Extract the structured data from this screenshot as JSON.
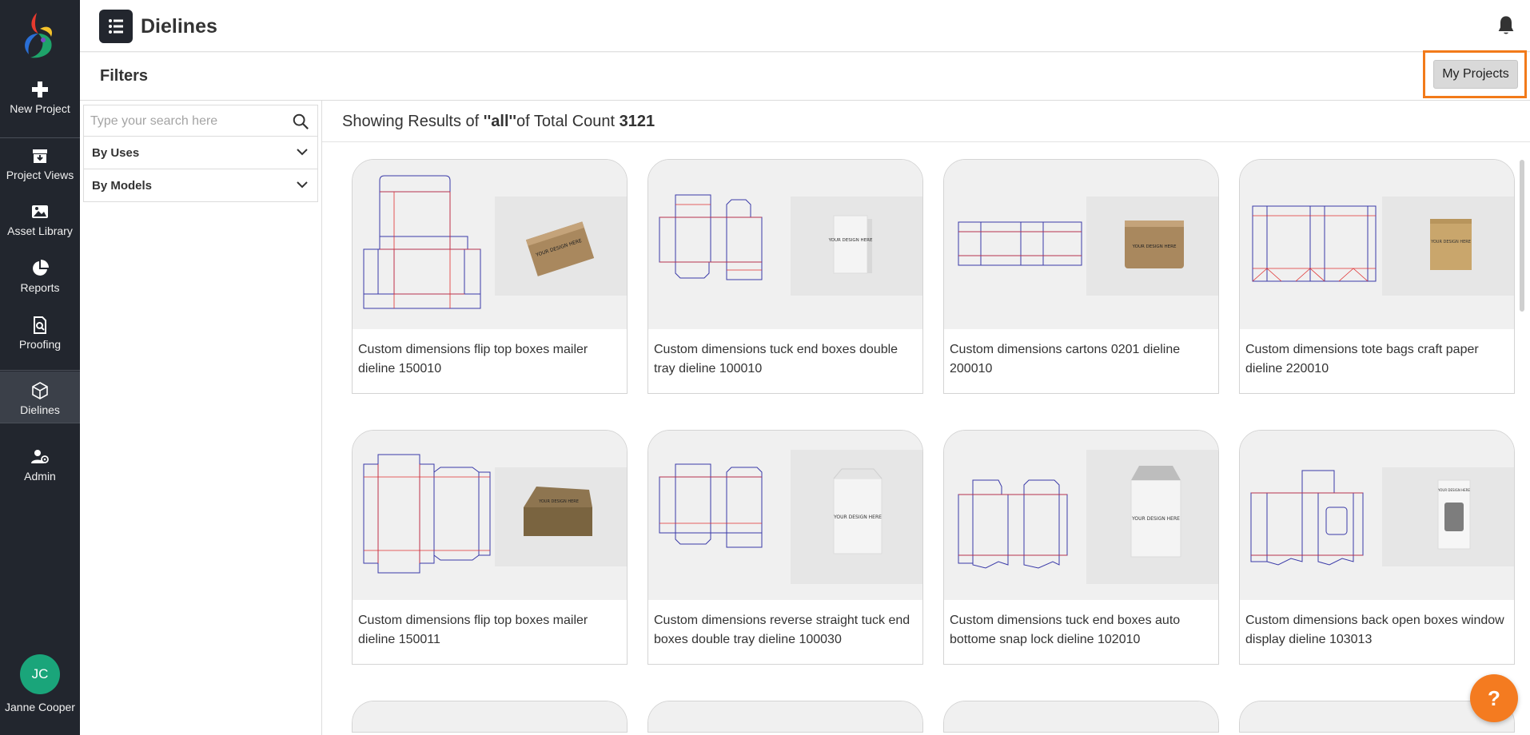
{
  "sidebar": {
    "items": [
      {
        "label": "New Project",
        "icon": "plus-icon"
      },
      {
        "label": "Project Views",
        "icon": "archive-icon"
      },
      {
        "label": "Asset Library",
        "icon": "image-icon"
      },
      {
        "label": "Reports",
        "icon": "pie-chart-icon"
      },
      {
        "label": "Proofing",
        "icon": "search-document-icon"
      },
      {
        "label": "Dielines",
        "icon": "box-icon",
        "active": true
      },
      {
        "label": "Admin",
        "icon": "user-settings-icon"
      }
    ],
    "user": {
      "initials": "JC",
      "name": "Janne Cooper"
    }
  },
  "header": {
    "title": "Dielines"
  },
  "filters": {
    "title": "Filters",
    "my_projects_label": "My Projects",
    "search_placeholder": "Type your search here",
    "groups": [
      {
        "label": "By Uses"
      },
      {
        "label": "By Models"
      }
    ]
  },
  "results": {
    "prefix": "Showing Results of ",
    "query": "''all''",
    "middle": "of Total Count ",
    "total": "3121"
  },
  "cards": [
    {
      "caption": "Custom dimensions flip top boxes mailer dieline 150010",
      "mockup_text": "YOUR DESIGN HERE"
    },
    {
      "caption": "Custom dimensions tuck end boxes double tray dieline 100010",
      "mockup_text": "YOUR DESIGN HERE"
    },
    {
      "caption": "Custom dimensions cartons 0201 dieline 200010",
      "mockup_text": "YOUR DESIGN HERE"
    },
    {
      "caption": "Custom dimensions tote bags craft paper dieline 220010",
      "mockup_text": "YOUR DESIGN HERE"
    },
    {
      "caption": "Custom dimensions flip top boxes mailer dieline 150011",
      "mockup_text": "YOUR DESIGN HERE"
    },
    {
      "caption": "Custom dimensions reverse straight tuck end boxes double tray dieline 100030",
      "mockup_text": "YOUR DESIGN HERE"
    },
    {
      "caption": "Custom dimensions tuck end boxes auto bottome snap lock dieline 102010",
      "mockup_text": "YOUR DESIGN HERE"
    },
    {
      "caption": "Custom dimensions back open boxes window display dieline 103013",
      "mockup_text": "YOUR DESIGN HERE"
    }
  ],
  "help": {
    "label": "?"
  },
  "colors": {
    "sidebar": "#22262e",
    "accent_orange": "#f27a1a",
    "avatar": "#1aa57a",
    "dieline_blue": "#3a3aa8",
    "dieline_red": "#e03030",
    "kraft": "#a9885e"
  }
}
